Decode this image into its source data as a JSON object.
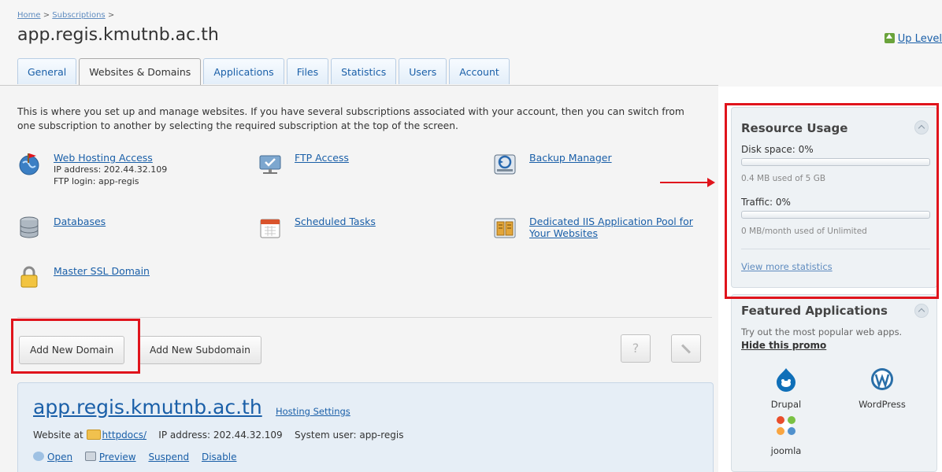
{
  "breadcrumb": {
    "home": "Home",
    "sep1": ">",
    "subscriptions": "Subscriptions",
    "sep2": ">"
  },
  "page_title": "app.regis.kmutnb.ac.th",
  "up_level": "Up Level",
  "tabs": [
    {
      "label": "General",
      "active": false
    },
    {
      "label": "Websites & Domains",
      "active": true
    },
    {
      "label": "Applications",
      "active": false
    },
    {
      "label": "Files",
      "active": false
    },
    {
      "label": "Statistics",
      "active": false
    },
    {
      "label": "Users",
      "active": false
    },
    {
      "label": "Account",
      "active": false
    }
  ],
  "intro": "This is where you set up and manage websites. If you have several subscriptions associated with your account, then you can switch from one subscription to another by selecting the required subscription at the top of the screen.",
  "tools": {
    "web_hosting": {
      "label": "Web Hosting Access",
      "ip": "IP address: 202.44.32.109",
      "ftp": "FTP login: app-regis"
    },
    "ftp": {
      "label": "FTP Access"
    },
    "backup": {
      "label": "Backup Manager"
    },
    "databases": {
      "label": "Databases"
    },
    "scheduled": {
      "label": "Scheduled Tasks"
    },
    "iis": {
      "label": "Dedicated IIS Application Pool for Your Websites"
    },
    "ssl": {
      "label": "Master SSL Domain"
    }
  },
  "buttons": {
    "add_domain": "Add New Domain",
    "add_subdomain": "Add New Subdomain",
    "help": "?"
  },
  "domain": {
    "name": "app.regis.kmutnb.ac.th",
    "hosting_settings": "Hosting Settings",
    "website_at": "Website at",
    "folder": "httpdocs/",
    "ip": "IP address: 202.44.32.109",
    "sysuser": "System user: app-regis",
    "actions": {
      "open": "Open",
      "preview": "Preview",
      "suspend": "Suspend",
      "disable": "Disable"
    }
  },
  "resource": {
    "title": "Resource Usage",
    "disk_label": "Disk space: 0%",
    "disk_fraction": 0.0,
    "disk_detail": "0.4 MB used of 5 GB",
    "traffic_label": "Traffic: 0%",
    "traffic_fraction": 0.0,
    "traffic_detail": "0 MB/month used of Unlimited",
    "more": "View more statistics"
  },
  "featured": {
    "title": "Featured Applications",
    "desc": "Try out the most popular web apps.",
    "hide": "Hide this promo",
    "apps": [
      {
        "name": "Drupal",
        "icon": "drupal-icon"
      },
      {
        "name": "WordPress",
        "icon": "wordpress-icon"
      },
      {
        "name": "joomla",
        "icon": "joomla-icon"
      }
    ]
  },
  "colors": {
    "link": "#1a5fa8",
    "annotation": "#e0141c",
    "panel": "#eef2f5"
  }
}
